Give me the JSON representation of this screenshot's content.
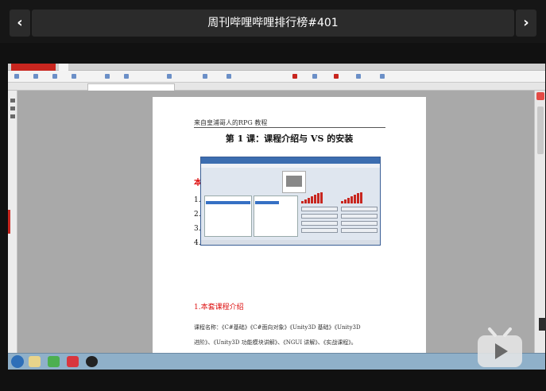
{
  "header": {
    "title": "周刊哔哩哔哩排行榜#401",
    "prev_glyph": "‹",
    "next_glyph": "›"
  },
  "document": {
    "page_header": "来自皇浦哥人的RPG 教程",
    "lesson_title": "第 1 课：课程介绍与 VS 的安装",
    "red_fragment": "本",
    "list_numbers": [
      "1.",
      "2.",
      "3.",
      "4."
    ],
    "section_heading": "1.本套课程介绍",
    "body_lines": [
      "课程名称：《C#基础》《C#面向对象》《Unity3D 基础》《Unity3D",
      "进阶》、《Unity3D 功能模块讲解》、《NGUI 讲解》、《实战课程》。"
    ]
  },
  "player": {
    "logo_icon": "bilibili-play-icon"
  },
  "colors": {
    "accent_red": "#c8261f",
    "header_bg": "#161616",
    "pill_bg": "#2b2b2b"
  }
}
